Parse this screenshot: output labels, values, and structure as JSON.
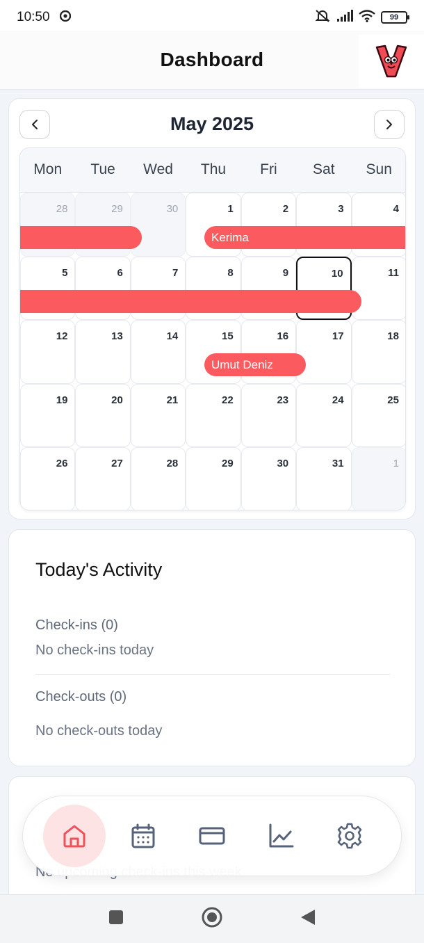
{
  "status_bar": {
    "time": "10:50",
    "battery": "99"
  },
  "header": {
    "title": "Dashboard"
  },
  "calendar": {
    "month_title": "May 2025",
    "weekdays": [
      "Mon",
      "Tue",
      "Wed",
      "Thu",
      "Fri",
      "Sat",
      "Sun"
    ],
    "weeks": [
      [
        "28",
        "29",
        "30",
        "1",
        "2",
        "3",
        "4"
      ],
      [
        "5",
        "6",
        "7",
        "8",
        "9",
        "10",
        "11"
      ],
      [
        "12",
        "13",
        "14",
        "15",
        "16",
        "17",
        "18"
      ],
      [
        "19",
        "20",
        "21",
        "22",
        "23",
        "24",
        "25"
      ],
      [
        "26",
        "27",
        "28",
        "29",
        "30",
        "31",
        "1"
      ]
    ],
    "today": "10",
    "events": [
      {
        "label": ""
      },
      {
        "label": "Kerima"
      },
      {
        "label": ""
      },
      {
        "label": "Umut Deniz"
      }
    ],
    "event_color": "#fb5a5f"
  },
  "activity": {
    "title": "Today's Activity",
    "checkins_label": "Check-ins (0)",
    "checkins_empty": "No check-ins today",
    "checkouts_label": "Check-outs (0)",
    "checkouts_empty": "No check-outs today"
  },
  "upcoming": {
    "empty": "No upcoming check-ins this week"
  },
  "bottom_nav": [
    {
      "name": "home",
      "icon": "home-icon",
      "active": true
    },
    {
      "name": "calendar",
      "icon": "calendar-icon",
      "active": false
    },
    {
      "name": "payments",
      "icon": "credit-card-icon",
      "active": false
    },
    {
      "name": "analytics",
      "icon": "chart-line-icon",
      "active": false
    },
    {
      "name": "settings",
      "icon": "gear-icon",
      "active": false
    }
  ],
  "colors": {
    "accent": "#f0505a",
    "active_bg": "#fde3e3",
    "icon_gray": "#56627a"
  }
}
